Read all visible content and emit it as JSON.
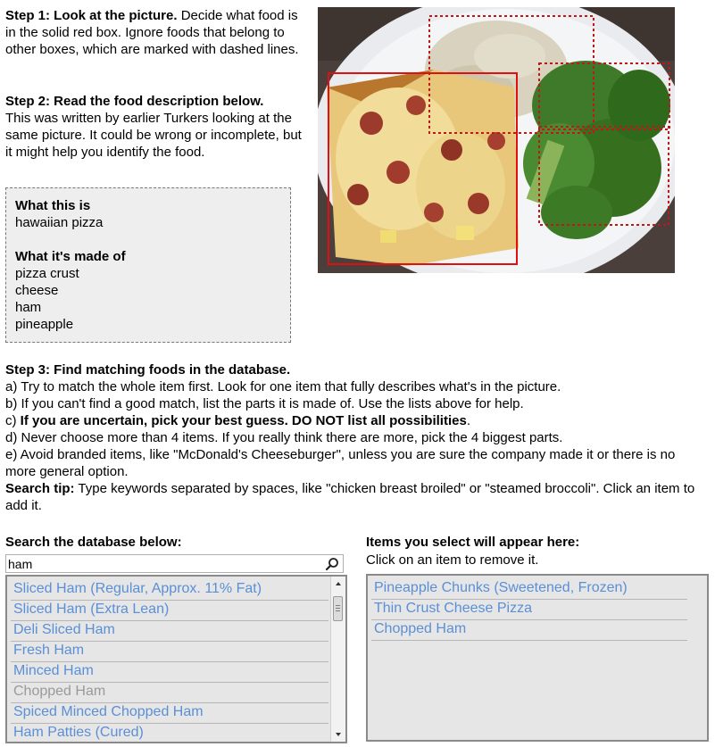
{
  "step1": {
    "heading": "Step 1: Look at the picture.",
    "text": " Decide what food is in the solid red box. Ignore foods that belong to other boxes, which are marked with dashed lines."
  },
  "step2": {
    "heading": "Step 2: Read the food description below.",
    "text": "This was written by earlier Turkers looking at the same picture. It could be wrong or incomplete, but it might help you identify the food."
  },
  "description": {
    "what_label": "What this is",
    "what_value": "hawaiian pizza",
    "made_label": "What it's made of",
    "ingredients": [
      "pizza crust",
      "cheese",
      "ham",
      "pineapple"
    ]
  },
  "step3": {
    "heading": "Step 3: Find matching foods in the database.",
    "a": "a) Try to match the whole item first. Look for one item that fully describes what's in the picture.",
    "b": "b) If you can't find a good match, list the parts it is made of. Use the lists above for help.",
    "c_prefix": "c) ",
    "c_bold": "If you are uncertain, pick your best guess. DO NOT list all possibilities",
    "c_suffix": ".",
    "d": "d) Never choose more than 4 items. If you really think there are more, pick the 4 biggest parts.",
    "e": "e) Avoid branded items, like \"McDonald's Cheeseburger\", unless you are sure the company made it or there is no more general option.",
    "tip_label": "Search tip:",
    "tip_text": " Type keywords separated by spaces, like \"chicken breast broiled\" or \"steamed broccoli\". Click an item to add it."
  },
  "search": {
    "label": "Search the database below:",
    "value": "ham",
    "results": [
      {
        "label": "Sliced Ham (Regular, Approx. 11% Fat)",
        "disabled": false
      },
      {
        "label": "Sliced Ham (Extra Lean)",
        "disabled": false
      },
      {
        "label": "Deli Sliced Ham",
        "disabled": false
      },
      {
        "label": "Fresh Ham",
        "disabled": false
      },
      {
        "label": "Minced Ham",
        "disabled": false
      },
      {
        "label": "Chopped Ham",
        "disabled": true
      },
      {
        "label": "Spiced Minced Chopped Ham",
        "disabled": false
      },
      {
        "label": "Ham Patties (Cured)",
        "disabled": false
      }
    ]
  },
  "selected": {
    "label": "Items you select will appear here:",
    "hint": "Click on an item to remove it.",
    "items": [
      "Pineapple Chunks (Sweetened, Frozen)",
      "Thin Crust Cheese Pizza",
      "Chopped Ham"
    ]
  },
  "colors": {
    "link": "#5b8fd6",
    "disabled": "#9a9a9a",
    "solid_box": "#e01010",
    "dashed_box": "#c01818"
  }
}
